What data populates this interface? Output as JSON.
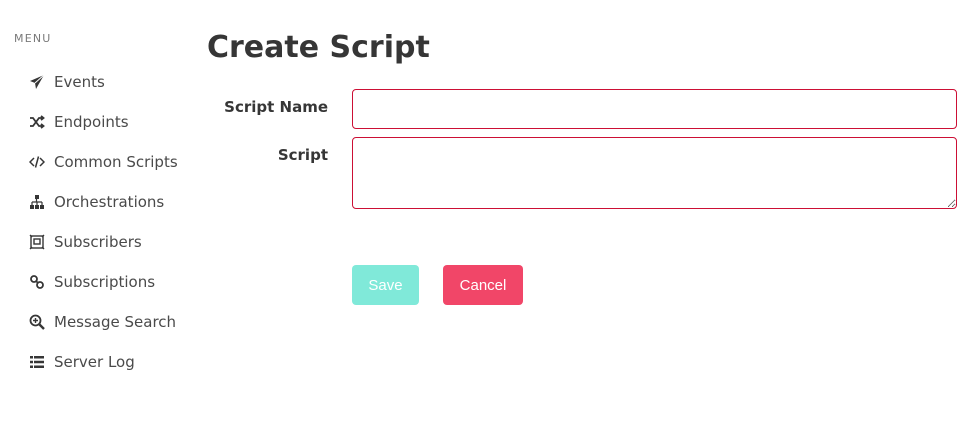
{
  "sidebar": {
    "menu_label": "MENU",
    "items": [
      {
        "label": "Events",
        "icon": "paper-plane-icon"
      },
      {
        "label": "Endpoints",
        "icon": "shuffle-icon"
      },
      {
        "label": "Common Scripts",
        "icon": "code-icon"
      },
      {
        "label": "Orchestrations",
        "icon": "sitemap-icon"
      },
      {
        "label": "Subscribers",
        "icon": "subscribers-icon"
      },
      {
        "label": "Subscriptions",
        "icon": "link-icon"
      },
      {
        "label": "Message Search",
        "icon": "search-plus-icon"
      },
      {
        "label": "Server Log",
        "icon": "list-icon"
      }
    ]
  },
  "main": {
    "title": "Create Script",
    "form": {
      "script_name_label": "Script Name",
      "script_name_value": "",
      "script_label": "Script",
      "script_value": ""
    },
    "buttons": {
      "save_label": "Save",
      "cancel_label": "Cancel"
    }
  },
  "colors": {
    "input_border_error": "#cc0f35",
    "save_button": "#80e9d9",
    "cancel_button": "#f14668"
  }
}
